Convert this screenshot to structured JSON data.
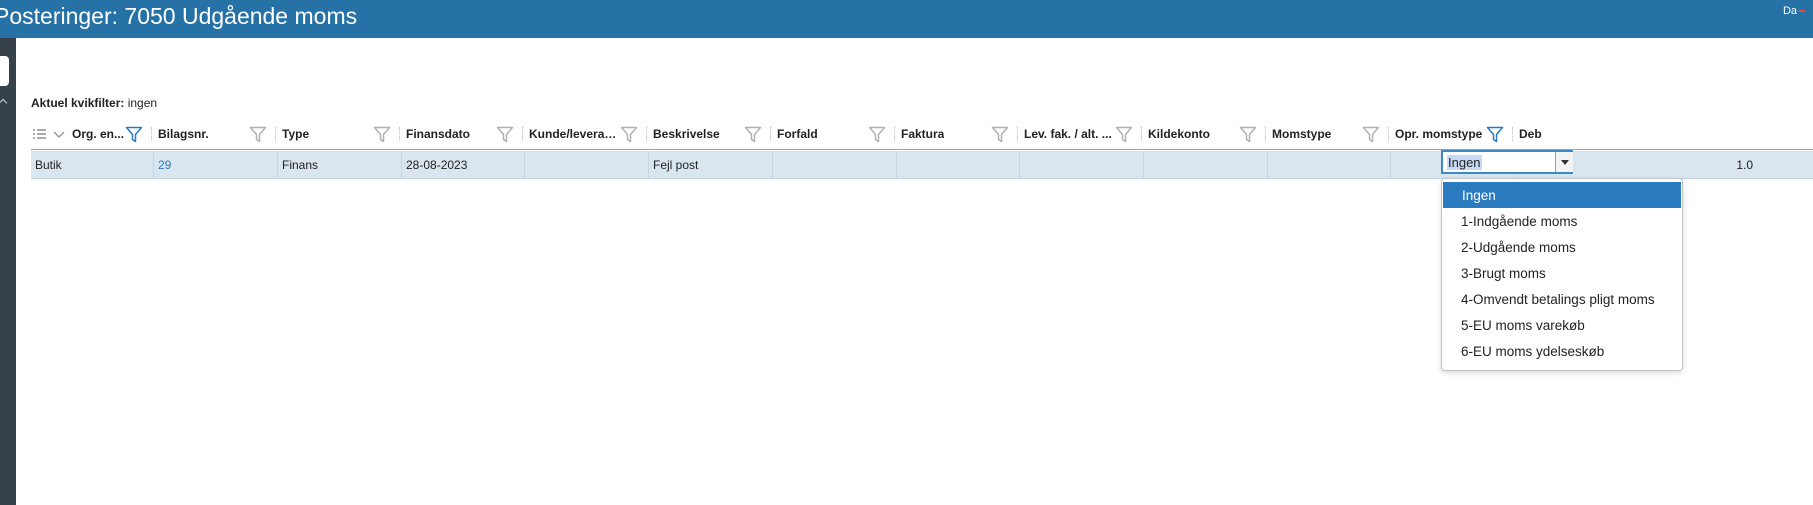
{
  "window": {
    "title": "Posteringer: 7050 Udgående moms",
    "language": "Da"
  },
  "quickfilter": {
    "label": "Aktuel kvikfilter:",
    "value": "ingen"
  },
  "columns": [
    {
      "label": "Org. en...",
      "filter_active": true
    },
    {
      "label": "Bilagsnr.",
      "filter_active": false
    },
    {
      "label": "Type",
      "filter_active": false
    },
    {
      "label": "Finansdato",
      "filter_active": false
    },
    {
      "label": "Kunde/leveran...",
      "filter_active": false
    },
    {
      "label": "Beskrivelse",
      "filter_active": false
    },
    {
      "label": "Forfald",
      "filter_active": false
    },
    {
      "label": "Faktura",
      "filter_active": false
    },
    {
      "label": "Lev. fak. / alt. ...",
      "filter_active": false
    },
    {
      "label": "Kildekonto",
      "filter_active": false
    },
    {
      "label": "Momstype",
      "filter_active": false
    },
    {
      "label": "Opr. momstype",
      "filter_active": true
    },
    {
      "label": "Deb",
      "filter_active": false
    }
  ],
  "rows": [
    {
      "cells": [
        "Butik",
        "29",
        "Finans",
        "28-08-2023",
        "",
        "Fejl post",
        "",
        "",
        "",
        "",
        "",
        "",
        "1.0"
      ]
    }
  ],
  "momstype_editor": {
    "value": "Ingen",
    "options": [
      "Ingen",
      "1-Indgående moms",
      "2-Udgående moms",
      "3-Brugt moms",
      "4-Omvendt betalings pligt moms",
      "5-EU moms varekøb",
      "6-EU moms ydelseskøb"
    ],
    "highlighted_index": 0
  },
  "colors": {
    "titlebar": "#2671a6",
    "rail": "#36414a",
    "row_selected": "#d9e6ef",
    "accent": "#2a7bc0",
    "filter_active": "#2a7bc0",
    "filter_inactive": "#b0b0b0"
  },
  "icons": {
    "filter": "filter-icon",
    "menu": "list-menu-icon",
    "chevron": "chevron-down-icon"
  }
}
